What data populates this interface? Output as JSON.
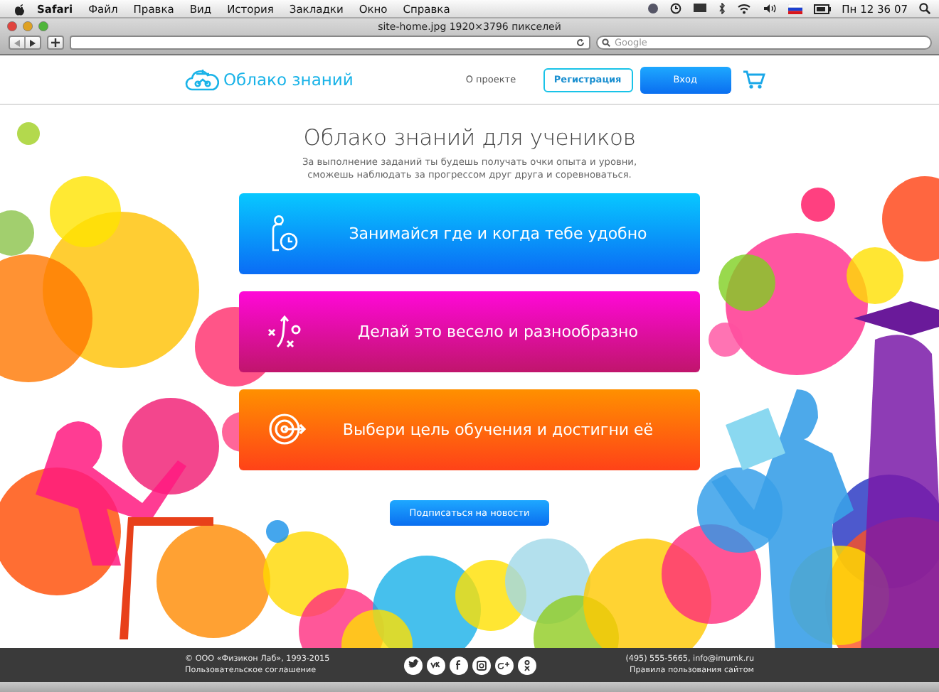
{
  "menubar": {
    "app": "Safari",
    "menus": [
      "Файл",
      "Правка",
      "Вид",
      "История",
      "Закладки",
      "Окно",
      "Справка"
    ],
    "clock": "Пн 12 36 07"
  },
  "browser": {
    "title": "site-home.jpg 1920×3796 пикселей",
    "search": {
      "placeholder": "Google"
    }
  },
  "header": {
    "logo": "Облако знаний",
    "nav": "О проекте",
    "register": "Регистрация",
    "login": "Вход"
  },
  "hero": {
    "title": "Облако знаний для учеников",
    "description": "За выполнение заданий ты будешь получать очки опыта и уровни, сможешь наблюдать за прогрессом друг друга и соревноваться."
  },
  "features": [
    {
      "kind": "schedule",
      "text": "Занимайся где и когда тебе удобно"
    },
    {
      "kind": "tactics",
      "text": "Делай это весело и разнообразно"
    },
    {
      "kind": "target",
      "text": "Выбери цель обучения и достигни её"
    }
  ],
  "subscribe": "Подписаться на новости",
  "footer": {
    "copyright": "© ООО «Физикон Лаб», 1993-2015",
    "agreement": "Пользовательское соглашение",
    "contacts": "(495) 555-5665, info@imumk.ru",
    "rules": "Правила пользования сайтом"
  }
}
